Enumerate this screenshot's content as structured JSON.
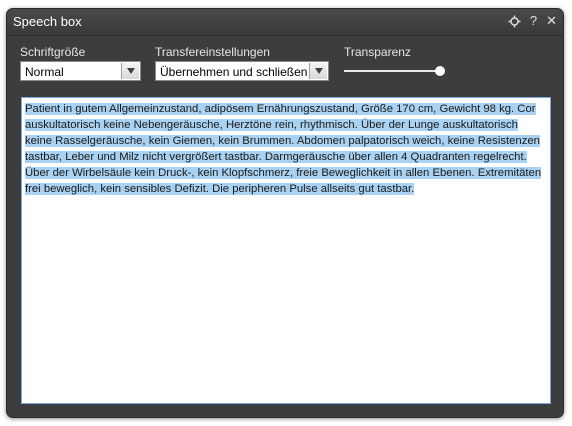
{
  "window": {
    "title": "Speech box"
  },
  "titlebar_icons": [
    "pin-icon",
    "help-icon",
    "close-icon"
  ],
  "titlebar_glyphs": {
    "help": "?",
    "close": "✕"
  },
  "controls": {
    "font_size": {
      "label": "Schriftgröße",
      "value": "Normal"
    },
    "transfer": {
      "label": "Transfereinstellungen",
      "value": "Übernehmen und schließen"
    },
    "transparency": {
      "label": "Transparenz",
      "level": 1.0
    }
  },
  "text": {
    "content": "Patient in gutem Allgemeinzustand, adipösem Ernährungszustand, Größe 170 cm, Gewicht 98 kg. Cor auskultatorisch keine Nebengeräusche, Herztöne rein, rhythmisch. Über der Lunge auskultatorisch keine Rasselgeräusche, kein Giemen, kein Brummen.  Abdomen palpatorisch weich, keine Resistenzen tastbar, Leber und Milz nicht vergrößert tastbar.  Darmgeräusche über allen 4 Quadranten regelrecht.  Über der Wirbelsäule kein Druck-, kein Klopfschmerz, freie Beweglichkeit in allen Ebenen.  Extremitäten frei beweglich, kein sensibles Defizit.  Die peripheren Pulse allseits gut tastbar.",
    "selected": true
  },
  "colors": {
    "selection": "#a9d1f2",
    "window_bg": "#3d3d3d"
  }
}
